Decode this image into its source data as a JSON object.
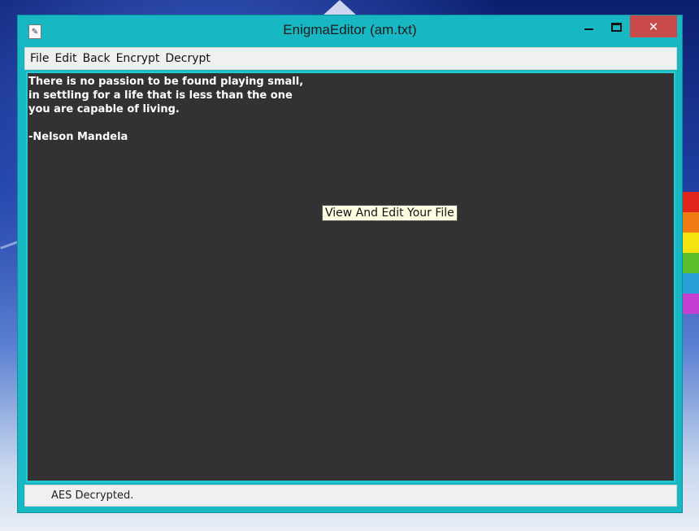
{
  "window": {
    "title": "EnigmaEditor (am.txt)",
    "close_glyph": "✕"
  },
  "menu": {
    "items": [
      "File",
      "Edit",
      "Back",
      "Encrypt",
      "Decrypt"
    ]
  },
  "editor": {
    "lines": [
      "There is no passion to be found playing small,",
      "in settling for a life that is less than the one",
      "you are capable of living.",
      "",
      "-Nelson Mandela"
    ],
    "background_color": "#323232",
    "text_color": "#ffffff"
  },
  "tooltip": {
    "text": "View And Edit Your File"
  },
  "status": {
    "text": "AES Decrypted."
  },
  "colors": {
    "window_frame": "#17b8c4",
    "close_button": "#c94a4a"
  }
}
